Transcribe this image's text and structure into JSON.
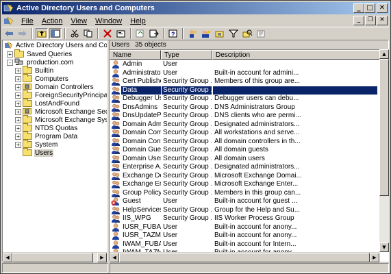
{
  "window": {
    "title": "Active Directory Users and Computers",
    "controls": {
      "minimize": "_",
      "maximize": "□",
      "close": "✕"
    }
  },
  "menu": {
    "items": [
      "File",
      "Action",
      "View",
      "Window",
      "Help"
    ],
    "mdi_controls": {
      "minimize": "_",
      "restore": "❐",
      "close": "✕"
    }
  },
  "toolbar": {
    "buttons": [
      "back-icon",
      "forward-icon",
      "up-folder-icon",
      "show-hide-tree-icon",
      "cut-icon",
      "copy-icon",
      "delete-icon",
      "properties-icon",
      "refresh-icon",
      "export-icon",
      "help-icon",
      "new-user-icon",
      "new-group-icon",
      "new-ou-icon",
      "filter-icon",
      "find-icon",
      "add-to-group-icon"
    ]
  },
  "tree": {
    "root": "Active Directory Users and Computer",
    "nodes": [
      {
        "label": "Saved Queries",
        "level": 1,
        "expander": "+",
        "icon": "folder"
      },
      {
        "label": "production.com",
        "level": 1,
        "expander": "-",
        "icon": "domain"
      },
      {
        "label": "Builtin",
        "level": 2,
        "expander": "+",
        "icon": "folder"
      },
      {
        "label": "Computers",
        "level": 2,
        "expander": "+",
        "icon": "folder"
      },
      {
        "label": "Domain Controllers",
        "level": 2,
        "expander": "+",
        "icon": "ou"
      },
      {
        "label": "ForeignSecurityPrincipals",
        "level": 2,
        "expander": "+",
        "icon": "folder"
      },
      {
        "label": "LostAndFound",
        "level": 2,
        "expander": "+",
        "icon": "folder"
      },
      {
        "label": "Microsoft Exchange Security",
        "level": 2,
        "expander": "+",
        "icon": "ou"
      },
      {
        "label": "Microsoft Exchange System C",
        "level": 2,
        "expander": "+",
        "icon": "folder"
      },
      {
        "label": "NTDS Quotas",
        "level": 2,
        "expander": "+",
        "icon": "folder"
      },
      {
        "label": "Program Data",
        "level": 2,
        "expander": "+",
        "icon": "folder"
      },
      {
        "label": "System",
        "level": 2,
        "expander": "+",
        "icon": "folder"
      },
      {
        "label": "Users",
        "level": 2,
        "expander": "",
        "icon": "folder",
        "selected": true
      }
    ]
  },
  "list": {
    "title": "Users",
    "count": "35 objects",
    "columns": [
      "Name",
      "Type",
      "Description"
    ],
    "rows": [
      {
        "icon": "user",
        "name": "Admin",
        "type": "User",
        "description": ""
      },
      {
        "icon": "user",
        "name": "Administrator",
        "type": "User",
        "description": "Built-in account for admini..."
      },
      {
        "icon": "group",
        "name": "Cert Publishers",
        "type": "Security Group ...",
        "description": "Members of this group are..."
      },
      {
        "icon": "group",
        "name": "Data",
        "type": "Security Group ...",
        "description": "",
        "selected": true
      },
      {
        "icon": "group",
        "name": "Debugger Us...",
        "type": "Security Group ...",
        "description": "Debugger users can debu..."
      },
      {
        "icon": "group",
        "name": "DnsAdmins",
        "type": "Security Group ...",
        "description": "DNS Administrators Group"
      },
      {
        "icon": "group",
        "name": "DnsUpdatePr...",
        "type": "Security Group ...",
        "description": "DNS clients who are permi..."
      },
      {
        "icon": "group",
        "name": "Domain Admins",
        "type": "Security Group ...",
        "description": "Designated administrators..."
      },
      {
        "icon": "group",
        "name": "Domain Com...",
        "type": "Security Group ...",
        "description": "All workstations and serve..."
      },
      {
        "icon": "group",
        "name": "Domain Cont...",
        "type": "Security Group ...",
        "description": "All domain controllers in th..."
      },
      {
        "icon": "group",
        "name": "Domain Guests",
        "type": "Security Group ...",
        "description": "All domain guests"
      },
      {
        "icon": "group",
        "name": "Domain Users",
        "type": "Security Group ...",
        "description": "All domain users"
      },
      {
        "icon": "group",
        "name": "Enterprise A...",
        "type": "Security Group ...",
        "description": "Designated administrators..."
      },
      {
        "icon": "group",
        "name": "Exchange Do...",
        "type": "Security Group ...",
        "description": "Microsoft Exchange Domai..."
      },
      {
        "icon": "group",
        "name": "Exchange En...",
        "type": "Security Group ...",
        "description": "Microsoft Exchange Enter..."
      },
      {
        "icon": "group",
        "name": "Group Policy ...",
        "type": "Security Group ...",
        "description": "Members in this group can..."
      },
      {
        "icon": "user-disabled",
        "name": "Guest",
        "type": "User",
        "description": "Built-in account for guest ..."
      },
      {
        "icon": "group",
        "name": "HelpServices...",
        "type": "Security Group ...",
        "description": "Group for the Help and Su..."
      },
      {
        "icon": "group",
        "name": "IIS_WPG",
        "type": "Security Group ...",
        "description": "IIS Worker Process Group"
      },
      {
        "icon": "user",
        "name": "IUSR_FUBAR",
        "type": "User",
        "description": "Built-in account for anony..."
      },
      {
        "icon": "user",
        "name": "IUSR_TAZMA...",
        "type": "User",
        "description": "Built-in account for anony..."
      },
      {
        "icon": "user",
        "name": "IWAM_FUBAR",
        "type": "User",
        "description": "Built-in account for Intern..."
      },
      {
        "icon": "user",
        "name": "IWAM_TAZM...",
        "type": "User",
        "description": "Built-in account for anony..."
      }
    ]
  },
  "colors": {
    "selection": "#0a246a",
    "titlebar_start": "#0a246a",
    "titlebar_end": "#a6caf0",
    "face": "#d4d0c8"
  }
}
